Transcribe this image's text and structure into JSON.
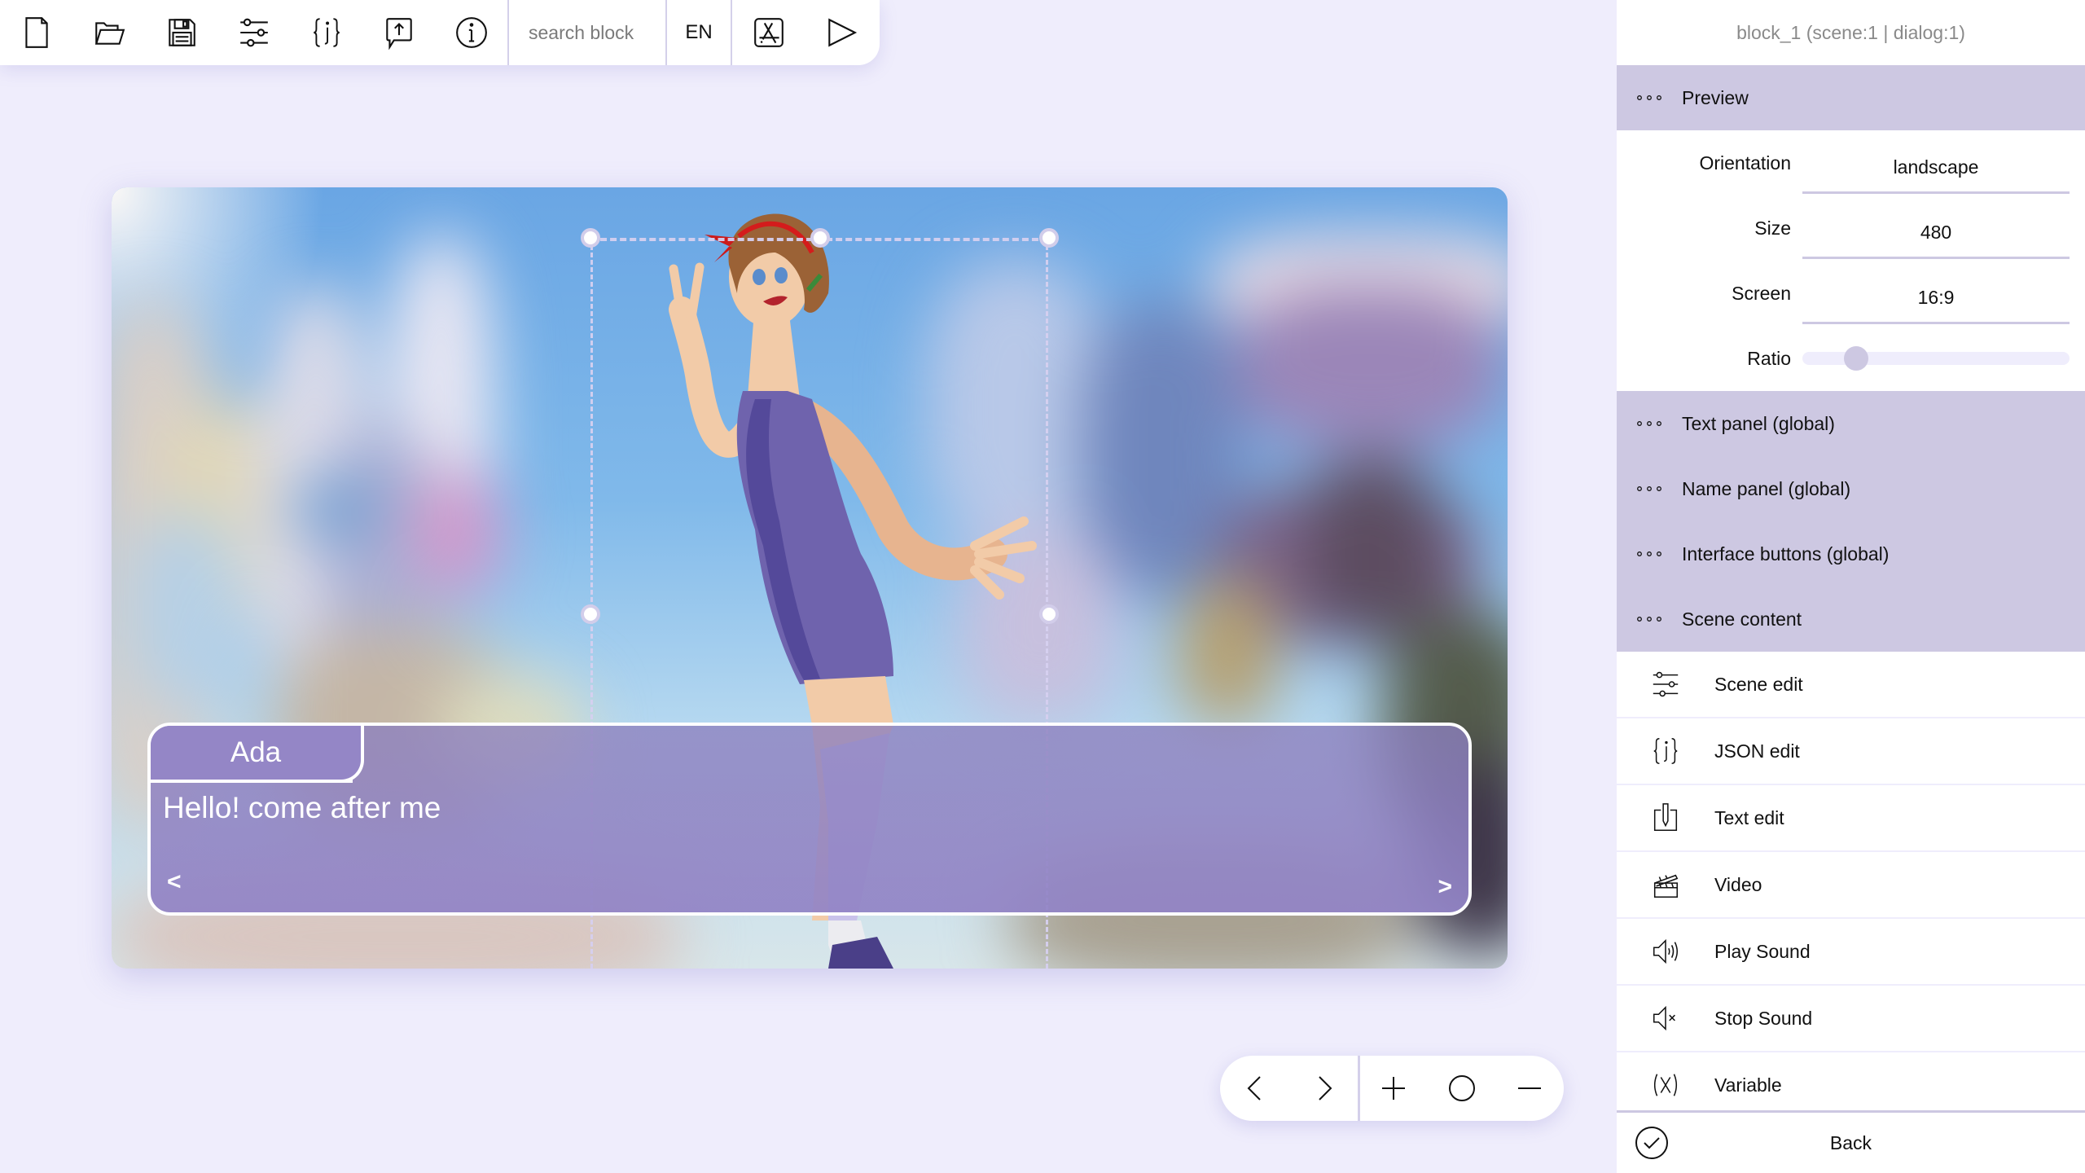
{
  "toolbar": {
    "buttons": [
      {
        "name": "new-file",
        "icon": "file-icon"
      },
      {
        "name": "open-folder",
        "icon": "folder-open-icon"
      },
      {
        "name": "save",
        "icon": "floppy-disk-icon"
      },
      {
        "name": "settings",
        "icon": "sliders-icon"
      },
      {
        "name": "json",
        "icon": "json-braces-icon"
      },
      {
        "name": "export",
        "icon": "speech-upload-icon"
      },
      {
        "name": "info",
        "icon": "info-icon"
      }
    ],
    "search_placeholder": "search block",
    "search_value": "",
    "language": "EN",
    "build_icon": "app-store-icon",
    "play_icon": "play-icon"
  },
  "stage": {
    "dialog": {
      "speaker": "Ada",
      "text": "Hello! come after me",
      "prev_label": "<",
      "next_label": ">"
    },
    "colors": {
      "dialog_panel": "#9486c6",
      "selection_handle": "#d2cdea"
    }
  },
  "nav_controls": {
    "buttons": [
      {
        "name": "previous",
        "icon": "chevron-left-icon"
      },
      {
        "name": "next",
        "icon": "chevron-right-icon"
      },
      {
        "name": "zoom-in",
        "icon": "plus-icon"
      },
      {
        "name": "zoom-reset",
        "icon": "circle-icon"
      },
      {
        "name": "zoom-out",
        "icon": "minus-icon"
      }
    ]
  },
  "panel": {
    "title": "block_1 (scene:1 | dialog:1)",
    "preview": {
      "label": "Preview",
      "orientation_label": "Orientation",
      "orientation_value": "landscape",
      "size_label": "Size",
      "size_value": "480",
      "screen_label": "Screen",
      "screen_value": "16:9",
      "ratio_label": "Ratio",
      "ratio_value": 0.2
    },
    "sections": [
      {
        "label": "Text panel (global)"
      },
      {
        "label": "Name panel (global)"
      },
      {
        "label": "Interface buttons (global)"
      },
      {
        "label": "Scene content"
      }
    ],
    "actions": [
      {
        "label": "Scene edit",
        "icon": "sliders-icon"
      },
      {
        "label": "JSON edit",
        "icon": "json-braces-icon"
      },
      {
        "label": "Text edit",
        "icon": "text-edit-icon"
      },
      {
        "label": "Video",
        "icon": "clapperboard-icon"
      },
      {
        "label": "Play Sound",
        "icon": "speaker-sound-icon"
      },
      {
        "label": "Stop Sound",
        "icon": "speaker-mute-icon"
      },
      {
        "label": "Variable",
        "icon": "variable-icon"
      }
    ],
    "back_label": "Back",
    "colors": {
      "section_bg": "#cdc8e2",
      "title_text": "#8a8a8a",
      "app_bg": "#efedfc"
    }
  }
}
